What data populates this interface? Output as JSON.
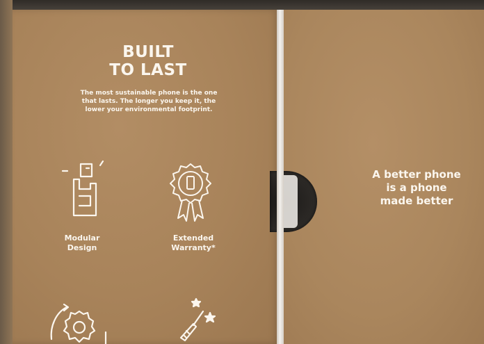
{
  "panel_left": {
    "headline_lines": [
      "BUILT",
      "TO LAST"
    ],
    "body_lines": [
      "The most sustainable phone is the one",
      "that lasts. The longer you keep it, the",
      "lower your environmental footprint."
    ],
    "features": [
      {
        "lines": [
          "Modular",
          "Design"
        ],
        "icon": "modular-phone-icon"
      },
      {
        "lines": [
          "Extended",
          "Warranty*"
        ],
        "icon": "warranty-ribbon-icon"
      }
    ],
    "partial_icons": [
      "gear-icon",
      "screwdriver-icon"
    ]
  },
  "panel_right": {
    "tagline_lines": [
      "A better phone",
      "is a phone",
      "made better"
    ]
  },
  "colors": {
    "cardboard": "#aa865d",
    "print": "#fbf6ee"
  }
}
